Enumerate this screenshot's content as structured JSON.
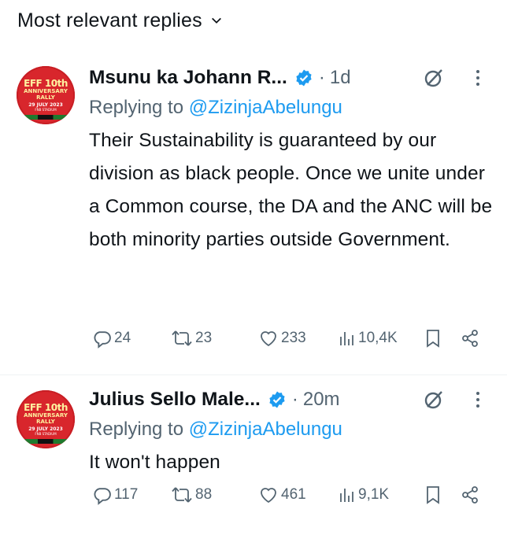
{
  "header": {
    "title": "Most relevant replies",
    "dropdown_icon": "chevron-down-icon"
  },
  "tweets": [
    {
      "avatar": {
        "line1": "EFF 10th",
        "line2": "ANNIVERSARY",
        "line3": "RALLY",
        "line4": "29 JULY 2023",
        "line5": "FNB STADIUM"
      },
      "name": "Msunu ka Johann R...",
      "time": "1d",
      "replying_prefix": "Replying to ",
      "replying_handle": "@ZizinjaAbelungu",
      "text": "Their Sustainability is guaranteed by our division as black people. Once we unite under a Common course, the DA and the ANC will be both minority parties outside Government.",
      "replies": "24",
      "retweets": "23",
      "likes": "233",
      "views": "10,4K"
    },
    {
      "avatar": {
        "line1": "EFF 10th",
        "line2": "ANNIVERSARY",
        "line3": "RALLY",
        "line4": "29 JULY 2023",
        "line5": "FNB STADIUM"
      },
      "name": "Julius Sello Male...",
      "time": "20m",
      "replying_prefix": "Replying to ",
      "replying_handle": "@ZizinjaAbelungu",
      "text": "It won't happen",
      "replies": "117",
      "retweets": "88",
      "likes": "461",
      "views": "9,1K"
    }
  ],
  "colors": {
    "accent": "#1d9bf0",
    "muted": "#536471",
    "text": "#0f1419"
  }
}
